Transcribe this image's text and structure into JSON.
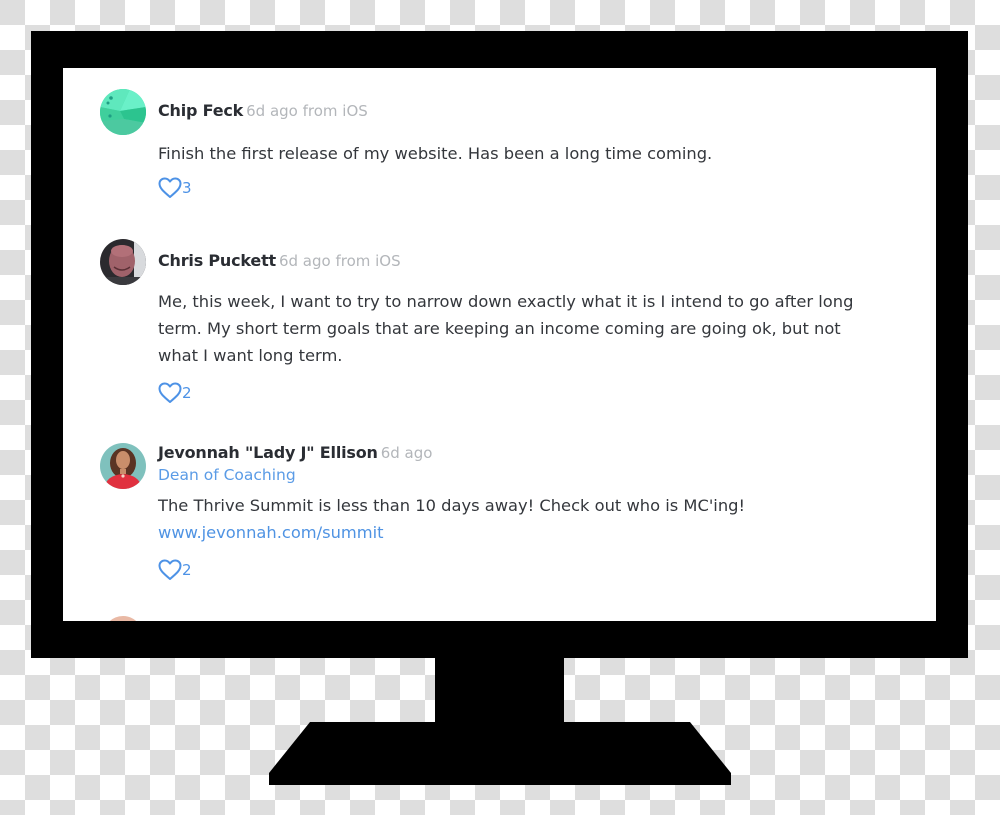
{
  "feed": {
    "posts": [
      {
        "author": "Chip Feck",
        "meta": "6d ago from iOS",
        "role": null,
        "body": "Finish the first release of my website. Has been a long time coming.",
        "link": null,
        "likes": "3",
        "avatar": "abstract-green-avatar"
      },
      {
        "author": "Chris Puckett",
        "meta": "6d ago from iOS",
        "role": null,
        "body": "Me, this week, I want to try to narrow down exactly what it is I intend to go after long term. My short term goals that are keeping an income coming are going ok, but not what I want long term.",
        "link": null,
        "likes": "2",
        "avatar": "man-photo-avatar"
      },
      {
        "author": "Jevonnah \"Lady J\" Ellison",
        "meta": "6d ago",
        "role": "Dean of Coaching",
        "body": "The Thrive Summit is less than 10 days away! Check out who is MC'ing!",
        "link": "www.jevonnah.com/summit",
        "likes": "2",
        "avatar": "woman-photo-avatar"
      }
    ]
  },
  "colors": {
    "accent": "#4d92e6",
    "author_text": "#2a2d33",
    "meta_text": "#b3b6ba",
    "body_text": "#34373c",
    "monitor": "#000000",
    "checker": "#dedede"
  }
}
